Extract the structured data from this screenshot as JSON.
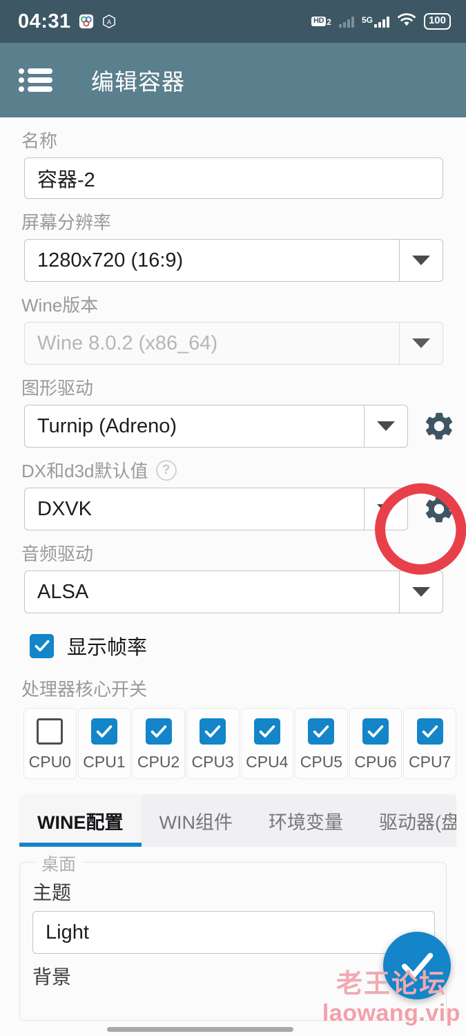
{
  "statusbar": {
    "time": "04:31",
    "app_icon_1": "chrome-like-icon",
    "app_icon_2": "hexagon-a-icon",
    "hd_label": "HD",
    "hd_sub": "2",
    "network_label": "5G",
    "wifi_icon": "wifi-icon",
    "battery": "100"
  },
  "appbar": {
    "menu_icon": "list-menu-icon",
    "title": "编辑容器"
  },
  "form": {
    "name": {
      "label": "名称",
      "value": "容器-2"
    },
    "resolution": {
      "label": "屏幕分辨率",
      "value": "1280x720 (16:9)"
    },
    "wine_version": {
      "label": "Wine版本",
      "value": "Wine 8.0.2 (x86_64)"
    },
    "graphics_driver": {
      "label": "图形驱动",
      "value": "Turnip (Adreno)",
      "gear_icon": "gear-icon"
    },
    "dx_d3d": {
      "label": "DX和d3d默认值",
      "help_icon": "?",
      "value": "DXVK",
      "gear_icon": "gear-icon"
    },
    "audio_driver": {
      "label": "音频驱动",
      "value": "ALSA"
    },
    "show_fps": {
      "label": "显示帧率",
      "checked": true
    },
    "cpu_section": {
      "label": "处理器核心开关",
      "cores": [
        {
          "name": "CPU0",
          "checked": false
        },
        {
          "name": "CPU1",
          "checked": true
        },
        {
          "name": "CPU2",
          "checked": true
        },
        {
          "name": "CPU3",
          "checked": true
        },
        {
          "name": "CPU4",
          "checked": true
        },
        {
          "name": "CPU5",
          "checked": true
        },
        {
          "name": "CPU6",
          "checked": true
        },
        {
          "name": "CPU7",
          "checked": true
        }
      ]
    }
  },
  "tabs": [
    {
      "label": "WINE配置",
      "active": true
    },
    {
      "label": "WIN组件",
      "active": false
    },
    {
      "label": "环境变量",
      "active": false
    },
    {
      "label": "驱动器(盘符",
      "active": false
    }
  ],
  "desktop_group": {
    "legend": "桌面",
    "theme_label": "主题",
    "theme_value": "Light",
    "background_label": "背景"
  },
  "fab": {
    "icon": "check-icon",
    "label": "确认"
  },
  "watermark": {
    "cn": "老王论坛",
    "en": "laowang.vip"
  },
  "colors": {
    "statusbar": "#3d5864",
    "appbar": "#5a7f8d",
    "accent_blue": "#1385c8",
    "annotation_red": "#e8404a",
    "gear": "#3e5563",
    "page_bg": "#fbfbfc"
  }
}
